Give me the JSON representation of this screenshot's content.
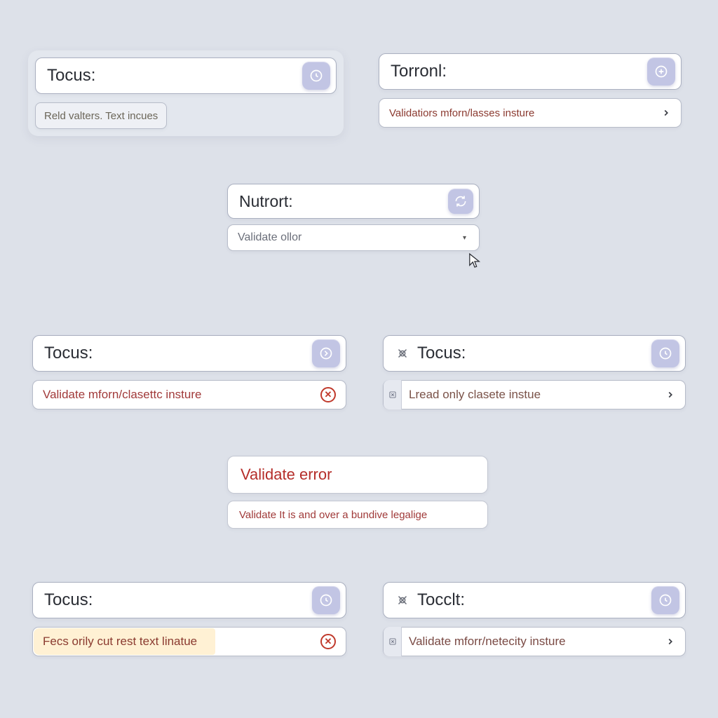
{
  "colors": {
    "accent": "#c2c5e4",
    "error": "#b52e2a",
    "border": "#aab0c0",
    "bg": "#dde1e9"
  },
  "cards": {
    "a": {
      "label": "Tocus:",
      "chip": "Reld valters. Text incues"
    },
    "b": {
      "label": "Torronl:",
      "msg": "Validatiors mforn/lasses insture"
    },
    "c": {
      "label": "Nutrort:",
      "select": "Validate ollor"
    },
    "d": {
      "label": "Tocus:",
      "msg": "Validate mforn/clasettc insture"
    },
    "e": {
      "label": "Tocus:",
      "msg": "Lread only clasete instue"
    },
    "f": {
      "title": "Validate error",
      "msg": "Validate It is and over a bundive legalige"
    },
    "g": {
      "label": "Tocus:",
      "msg": "Fecs orily cut rest text linatue"
    },
    "h": {
      "label": "Tocclt:",
      "msg": "Validate mforr/netecity insture"
    }
  }
}
